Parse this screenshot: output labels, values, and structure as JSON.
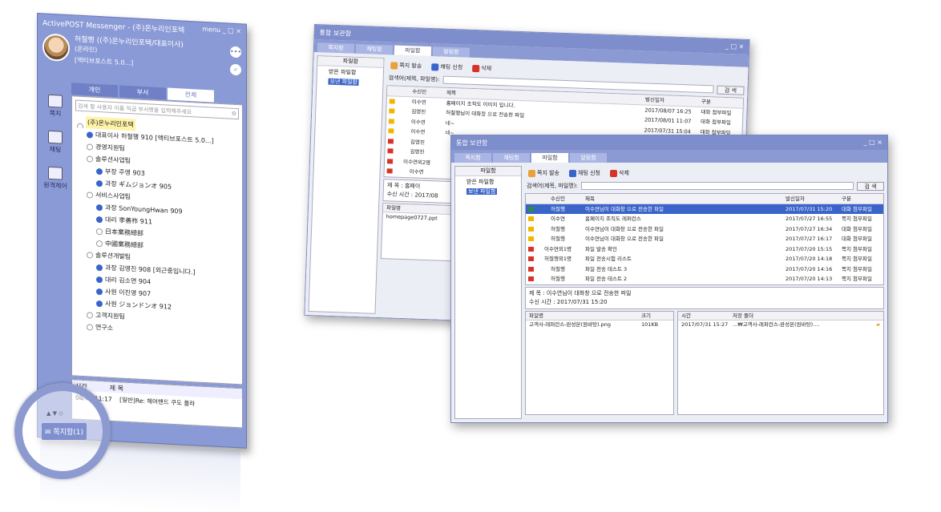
{
  "messenger": {
    "title": "ActivePOST Messenger - (주)온누리인포텍",
    "menu_label": "menu",
    "window_controls": "_ □ ×",
    "user_name": "허철행 ((주)온누리인포텍/대표이사)",
    "user_status": "(온라인)",
    "user_message": "[액티브포스트 5.0...]",
    "tabs": [
      "개인",
      "부서",
      "전체"
    ],
    "search_placeholder": "검색 할 사용자 이름 직급 부서명을 입력해주세요",
    "left_menu": [
      {
        "label": "쪽지",
        "icon": "note-icon"
      },
      {
        "label": "채팅",
        "icon": "chat-icon"
      },
      {
        "label": "원격제어",
        "icon": "remote-icon"
      }
    ],
    "tree": [
      {
        "text": "(주)온누리인포텍",
        "kind": "company",
        "indent": 0
      },
      {
        "text": "대표이사 허철행 910 [액티브포스트 5.0...]",
        "kind": "user",
        "indent": 1
      },
      {
        "text": "경영지원팀",
        "kind": "group",
        "indent": 1
      },
      {
        "text": "솔루션사업팀",
        "kind": "group",
        "indent": 1
      },
      {
        "text": "부장 주영 903",
        "kind": "user",
        "indent": 2
      },
      {
        "text": "과장 ギムジョンオ 905",
        "kind": "user",
        "indent": 2
      },
      {
        "text": "서비스사업팀",
        "kind": "group",
        "indent": 1
      },
      {
        "text": "과장 SonYoungHwan 909",
        "kind": "user",
        "indent": 2
      },
      {
        "text": "대리 李善祚 911",
        "kind": "user",
        "indent": 2
      },
      {
        "text": "日本業務總部",
        "kind": "group",
        "indent": 2
      },
      {
        "text": "中國業務總部",
        "kind": "group",
        "indent": 2
      },
      {
        "text": "솔루션개발팀",
        "kind": "group",
        "indent": 1
      },
      {
        "text": "과장 김영진 908 [외근중입니다.]",
        "kind": "user",
        "indent": 2
      },
      {
        "text": "대리 김소연 904",
        "kind": "user",
        "indent": 2
      },
      {
        "text": "사원 이진영 907",
        "kind": "user",
        "indent": 2
      },
      {
        "text": "사원 ジョンドンオ 912",
        "kind": "user",
        "indent": 2
      },
      {
        "text": "고객지원팀",
        "kind": "group",
        "indent": 1
      },
      {
        "text": "연구소",
        "kind": "group",
        "indent": 1
      }
    ],
    "bottom_headers": [
      "시간",
      "제 목"
    ],
    "bottom_row": {
      "time": "08/01 11:17",
      "subject": "[일반]Re: 헤어밴드 쿠도 플라"
    },
    "status_bar": "쪽지함(1)",
    "magnifier_arrows": "▲ ▼ ◇"
  },
  "back_window": {
    "title": "통합 보관함",
    "controls": "_ □ ×",
    "tabs": [
      "쪽지함",
      "채팅함",
      "파일함",
      "알림함"
    ],
    "active_tab": 2,
    "tree_header": "파일함",
    "tree_items": [
      "받은 파일함",
      "보낸 파일함"
    ],
    "toolbar": [
      "쪽지 발송",
      "채팅 신청",
      "삭제"
    ],
    "search_label": "검색어(제목, 파일명):",
    "search_button": "검 색",
    "columns": [
      "수신인",
      "제목",
      "발신일자",
      "구분"
    ],
    "rows": [
      {
        "sender": "이수연",
        "subject": "홈페이지 조직도 이미지 입니다.",
        "date": "2017/08/07 16:25",
        "kind": "대화 첨부파일"
      },
      {
        "sender": "김영진",
        "subject": "허철행님이 대화창 으로 전송한 파일",
        "date": "2017/08/01 11:07",
        "kind": "대화 첨부파일"
      },
      {
        "sender": "이수연",
        "subject": "네~",
        "date": "2017/07/31 15:04",
        "kind": "대화 첨부파일"
      },
      {
        "sender": "이수연",
        "subject": "네~",
        "date": "2017/07/31 15:00",
        "kind": "대화 첨부파일"
      },
      {
        "sender": "김영진",
        "subject": "",
        "date": "",
        "kind": ""
      },
      {
        "sender": "김영진",
        "subject": "",
        "date": "",
        "kind": ""
      },
      {
        "sender": "이수연외2명",
        "subject": "",
        "date": "",
        "kind": ""
      },
      {
        "sender": "이수연",
        "subject": "",
        "date": "",
        "kind": ""
      }
    ],
    "detail_subject": "제 목 : 홈페이",
    "detail_time": "수신 시간 : 2017/08",
    "file_header": "파일명",
    "file_row": "homepage0727.ppt"
  },
  "front_window": {
    "title": "통합 보관함",
    "controls": "_ □ ×",
    "tabs": [
      "쪽지함",
      "채팅함",
      "파일함",
      "알림함"
    ],
    "active_tab": 2,
    "tree_header": "파일함",
    "tree_items": [
      "받은 파일함",
      "보낸 파일함"
    ],
    "toolbar": [
      "쪽지 발송",
      "채팅 신청",
      "삭제"
    ],
    "search_label": "검색어(제목, 파일명):",
    "search_button": "검 색",
    "columns": [
      "수신인",
      "제목",
      "발신일자",
      "구분"
    ],
    "rows": [
      {
        "sender": "허철행",
        "subject": "이수연님이 대화창 으로 전송한 파일",
        "date": "2017/07/31 15:20",
        "kind": "대화 첨부파일",
        "selected": true
      },
      {
        "sender": "이수연",
        "subject": "홈페이지 조직도 레퍼런스",
        "date": "2017/07/27 16:55",
        "kind": "쪽지 첨부파일"
      },
      {
        "sender": "허철행",
        "subject": "이수연님이 대화창 으로 전송한 파일",
        "date": "2017/07/27 16:34",
        "kind": "대화 첨부파일"
      },
      {
        "sender": "허철행",
        "subject": "이수연님이 대화창 으로 전송한 파일",
        "date": "2017/07/27 16:17",
        "kind": "대화 첨부파일"
      },
      {
        "sender": "이수연외1명",
        "subject": "파일 발송 확인",
        "date": "2017/07/20 15:15",
        "kind": "쪽지 첨부파일"
      },
      {
        "sender": "허철행외1명",
        "subject": "파일 전송시험 리스트",
        "date": "2017/07/20 14:18",
        "kind": "쪽지 첨부파일"
      },
      {
        "sender": "허철행",
        "subject": "파일 전송 테스트 3",
        "date": "2017/07/20 14:16",
        "kind": "쪽지 첨부파일"
      },
      {
        "sender": "허철행",
        "subject": "파일 전송 테스트 2",
        "date": "2017/07/20 14:13",
        "kind": "쪽지 첨부파일"
      }
    ],
    "detail_subject": "제 목 : 이수연님이 대화창 으로 전송한 파일",
    "detail_time": "수신 시간 : 2017/07/31 15:20",
    "file_headers": [
      "파일명",
      "크기"
    ],
    "file_row": {
      "name": "고객사-레퍼런스-완성본(원바탕).png",
      "size": "101KB"
    },
    "save_headers": [
      "시간",
      "저장 폴더"
    ],
    "save_row": {
      "time": "2017/07/31 15:27",
      "folder": "...₩고객사-레퍼런스-완성본(원바탕)...."
    }
  },
  "colors": {
    "messenger_frame": "#8a9ad6",
    "window_title": "#7e8dcb",
    "selection": "#3a64c9",
    "company_highlight": "#fff3a8",
    "mail_yellow": "#f2b600",
    "mail_red": "#d8332a",
    "mail_green": "#2d8a4a"
  }
}
